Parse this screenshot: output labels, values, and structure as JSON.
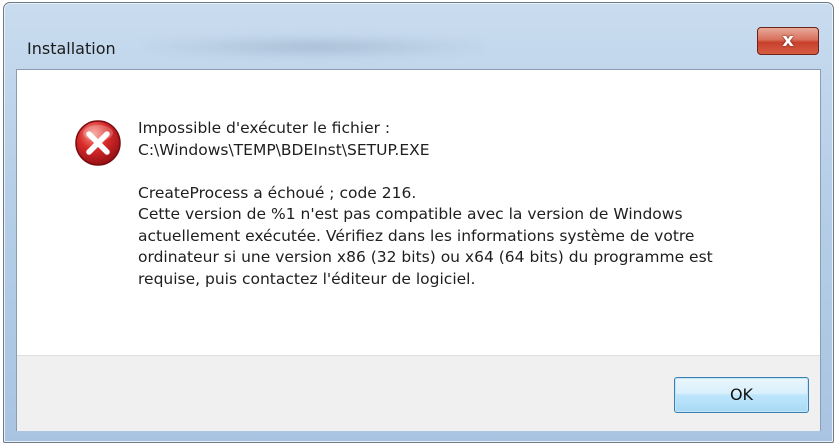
{
  "window": {
    "title": "Installation"
  },
  "titlebar": {
    "close_label": "x"
  },
  "icon": {
    "name": "error-icon",
    "color": "#c8202b"
  },
  "message": {
    "lines_block1": [
      "Impossible d'exécuter le fichier :",
      "C:\\Windows\\TEMP\\BDEInst\\SETUP.EXE"
    ],
    "lines_block2": [
      "CreateProcess a échoué ; code 216.",
      "Cette version de %1 n'est pas compatible avec la version de Windows",
      "actuellement exécutée. Vérifiez dans les informations système de votre",
      "ordinateur si une version x86 (32 bits) ou x64 (64 bits) du programme est",
      "requise, puis contactez l'éditeur de logiciel."
    ]
  },
  "buttons": {
    "ok_label": "OK"
  }
}
